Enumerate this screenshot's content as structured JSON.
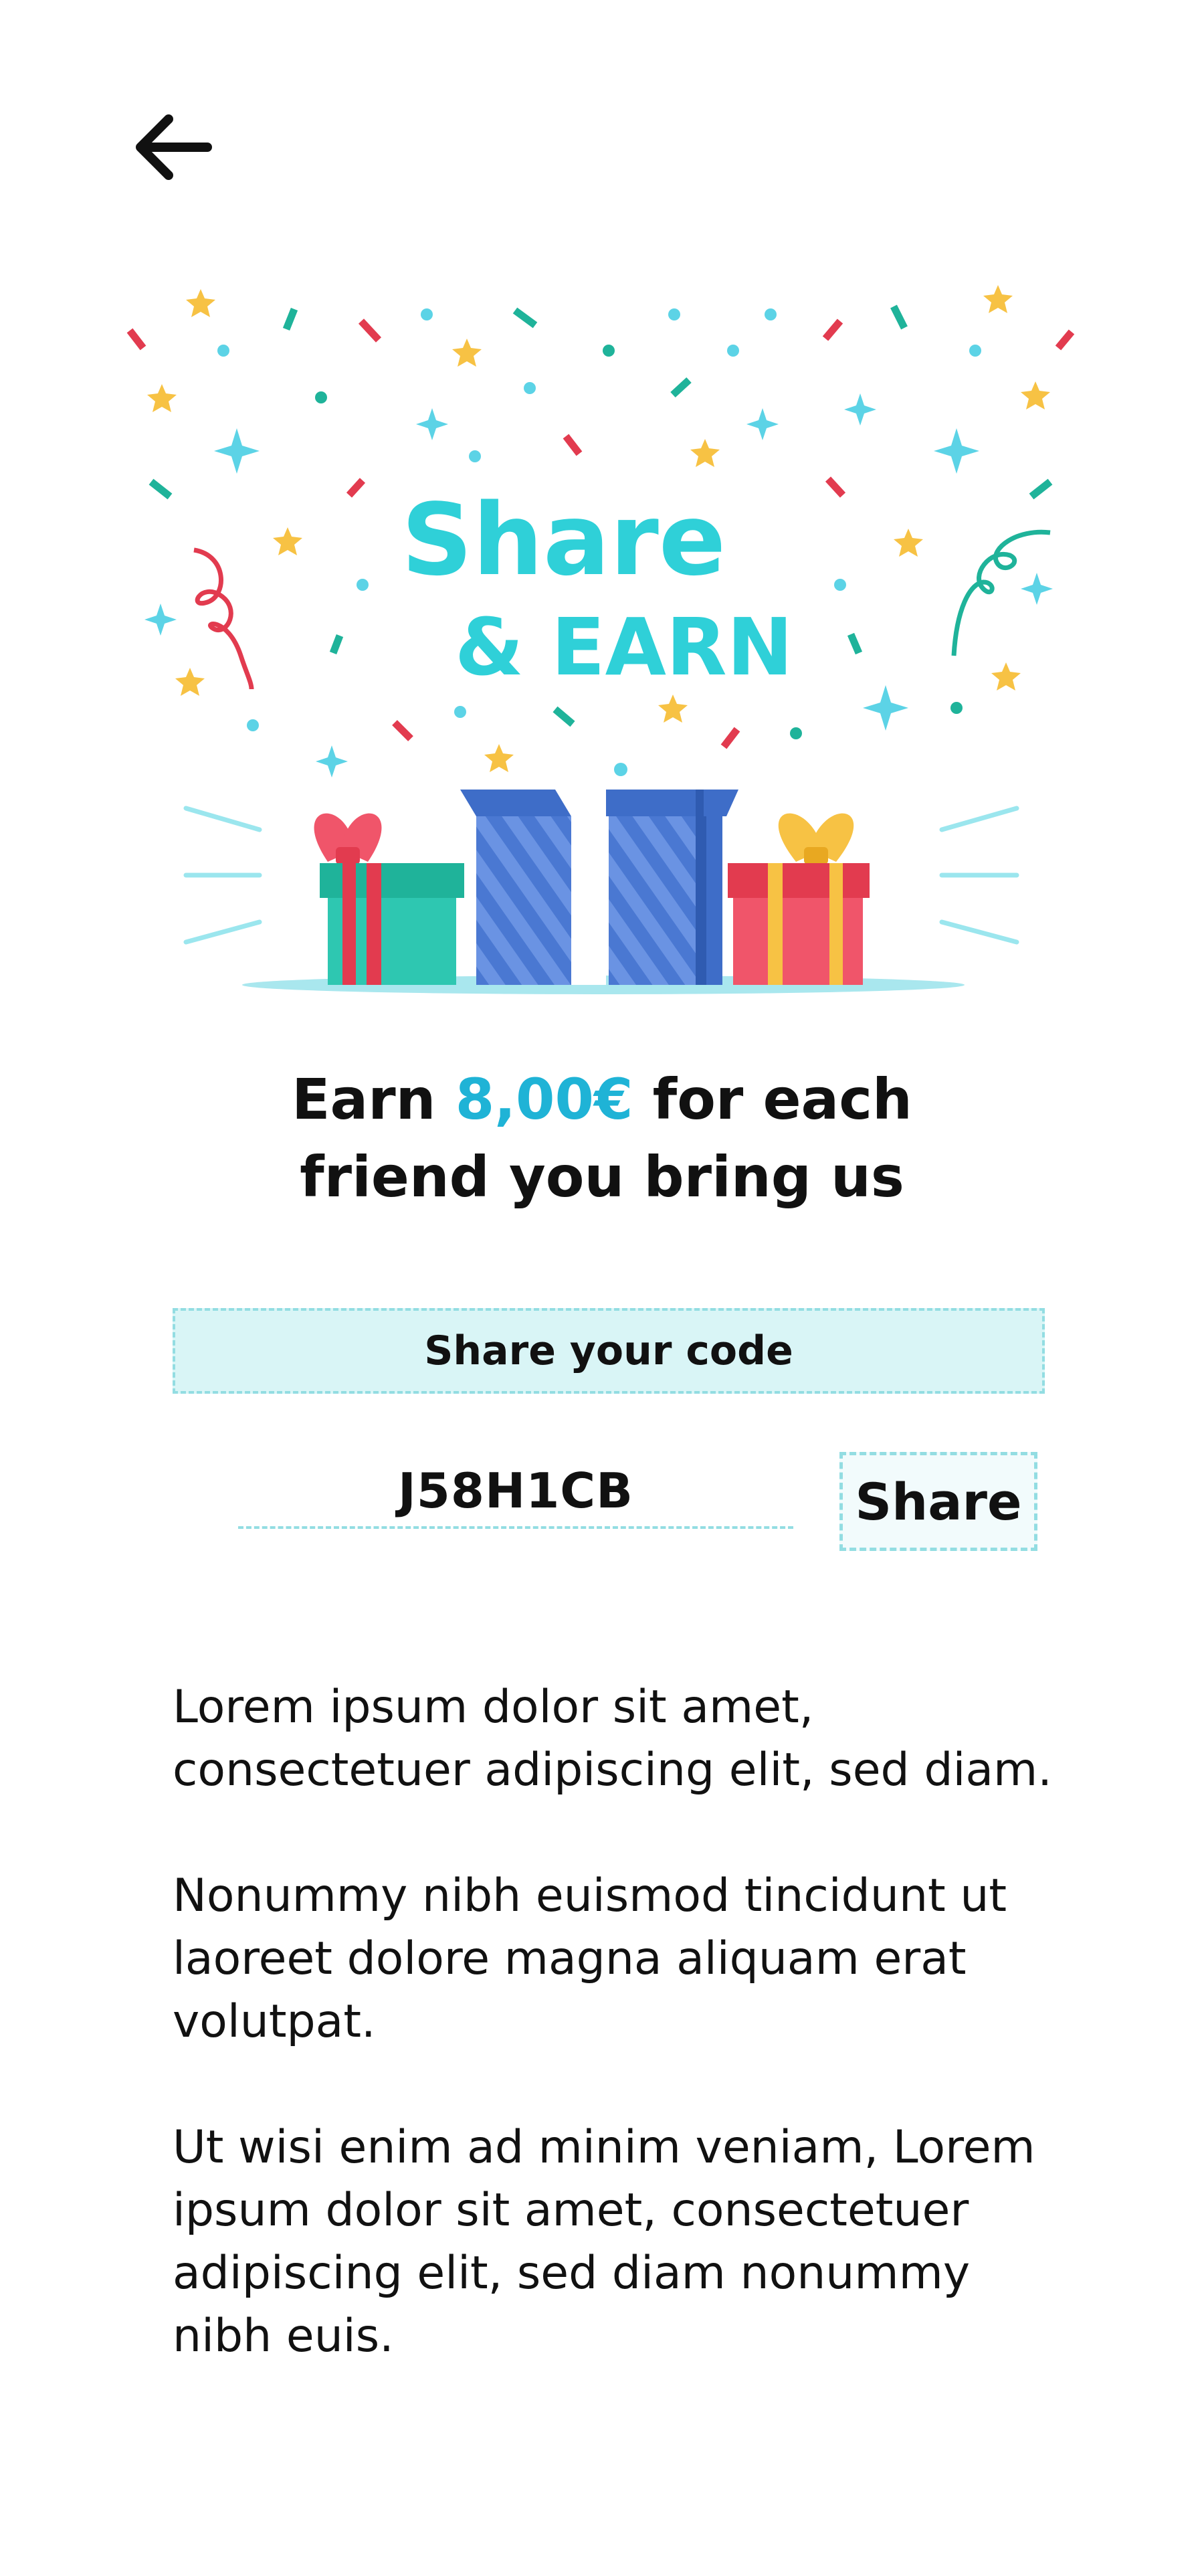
{
  "nav": {
    "back_icon": "arrow-left-icon"
  },
  "hero": {
    "logo_line1": "Share",
    "logo_line2": "& EARN",
    "colors": {
      "teal": "#2fd0d8",
      "red": "#e23b4f",
      "green": "#1fb39a",
      "yellow": "#f7c244",
      "cyan": "#5cd3e6",
      "blue": "#3e6dc8",
      "blue_light": "#5a86dc"
    }
  },
  "headline": {
    "prefix": "Earn ",
    "amount": "8,00€",
    "suffix_line1": " for each",
    "line2": "friend you bring us"
  },
  "share_section": {
    "banner_label": "Share your code",
    "code": "J58H1CB",
    "share_button_label": "Share"
  },
  "description": {
    "paragraphs": [
      "Lorem ipsum dolor sit amet, consectetuer adipiscing elit, sed diam.",
      "Nonummy nibh euismod tincidunt ut laoreet dolore magna aliquam erat volutpat.",
      "Ut wisi enim ad minim veniam, Lorem ipsum dolor sit amet, consectetuer adipiscing elit, sed diam nonummy nibh euis."
    ]
  }
}
